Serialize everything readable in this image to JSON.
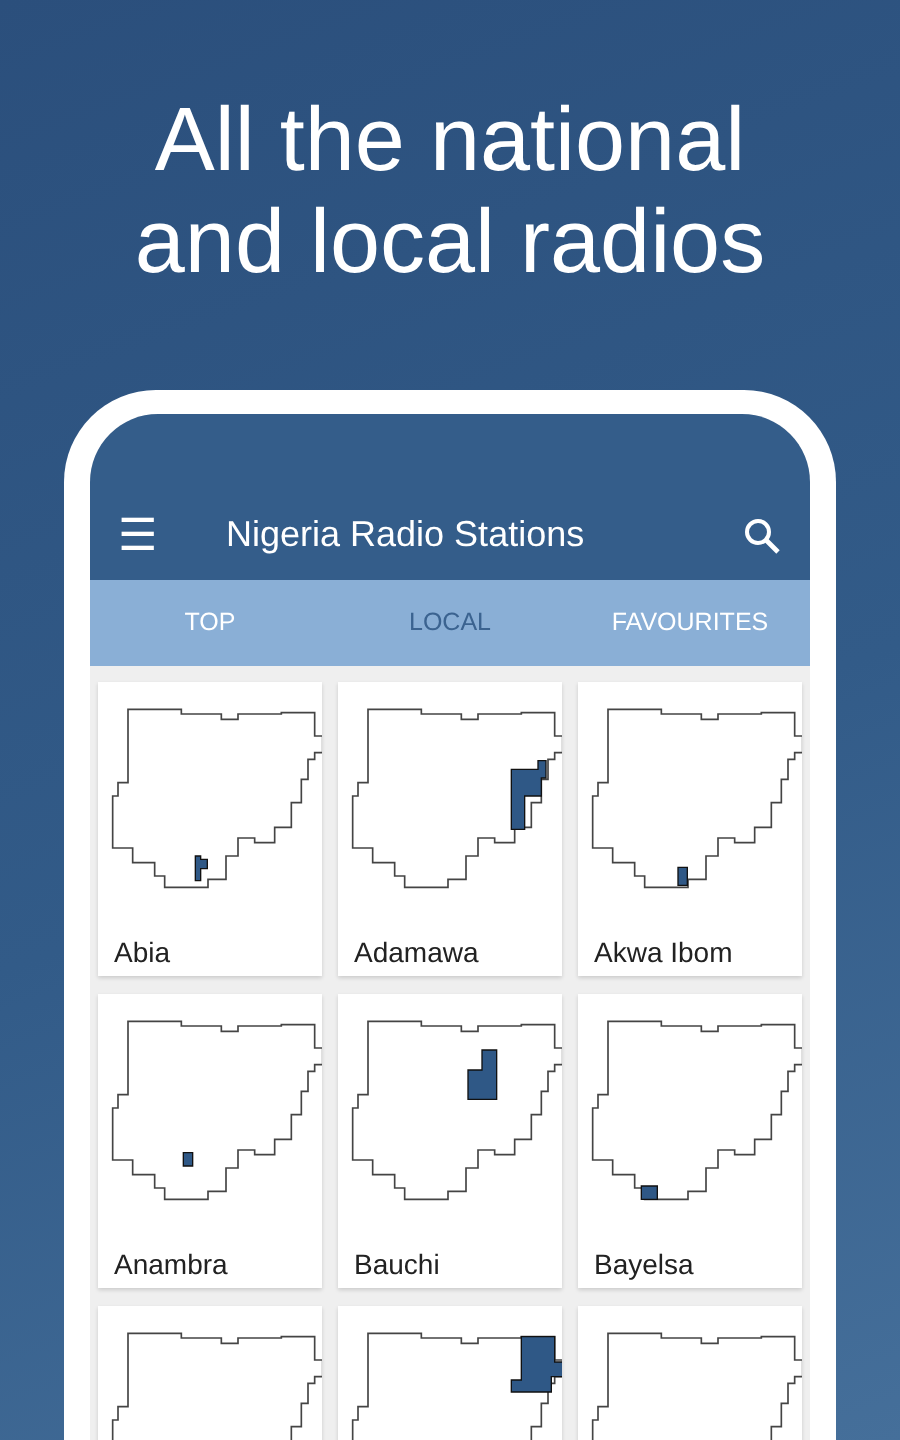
{
  "headline_lines": [
    "All the national",
    "and local radios"
  ],
  "app_bar": {
    "menu_icon": "☰",
    "title": "Nigeria Radio Stations"
  },
  "tabs": [
    {
      "label": "TOP",
      "selected": false
    },
    {
      "label": "LOCAL",
      "selected": true
    },
    {
      "label": "FAVOURITES",
      "selected": false
    }
  ],
  "stations": [
    {
      "kind": "full",
      "name": "Abia"
    },
    {
      "kind": "full",
      "name": "Adamawa"
    },
    {
      "kind": "full",
      "name": "Akwa Ibom"
    },
    {
      "kind": "full",
      "name": "Anambra"
    },
    {
      "kind": "full",
      "name": "Bauchi"
    },
    {
      "kind": "full",
      "name": "Bayelsa"
    },
    {
      "kind": "partial"
    },
    {
      "kind": "partial"
    },
    {
      "kind": "partial"
    }
  ]
}
